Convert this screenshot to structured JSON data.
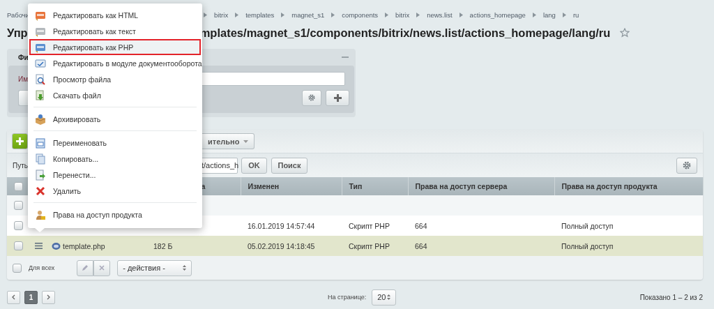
{
  "breadcrumbs": [
    "Рабочи",
    "bitrix",
    "templates",
    "magnet_s1",
    "components",
    "bitrix",
    "news.list",
    "actions_homepage",
    "lang",
    "ru"
  ],
  "title": {
    "start": "Упр",
    "end": "mplates/magnet_s1/components/bitrix/news.list/actions_homepage/lang/ru"
  },
  "filter": {
    "title": "Фи",
    "field_label": "Им"
  },
  "toolbar": {
    "more_label": "ительно"
  },
  "path": {
    "label": "Путь",
    "value": "t/actions_h",
    "ok": "OK",
    "search": "Поиск"
  },
  "table": {
    "all_checked": false,
    "columns": [
      "а",
      "Изменен",
      "Тип",
      "Права на доступ сервера",
      "Права на доступ продукта"
    ],
    "rows": [
      {
        "kind": "blank",
        "selected": false,
        "checked": false
      },
      {
        "kind": "file",
        "selected": false,
        "checked": false,
        "modified": "16.01.2019 14:57:44",
        "type": "Скрипт PHP",
        "server_rights": "664",
        "product_rights": "Полный доступ"
      },
      {
        "kind": "file",
        "selected": true,
        "checked": false,
        "name": "template.php",
        "size": "182 Б",
        "modified": "05.02.2019 14:18:45",
        "type": "Скрипт PHP",
        "server_rights": "664",
        "product_rights": "Полный доступ"
      }
    ]
  },
  "footer": {
    "all_checked": false,
    "all_label": "Для всех",
    "actions": "- действия -"
  },
  "pagination": {
    "pages": [
      {
        "label": "1",
        "selected": true
      }
    ],
    "per_page_label": "На странице:",
    "per_page": "20",
    "summary": "Показано 1 – 2 из 2"
  },
  "menu": {
    "items": [
      {
        "kind": "item",
        "label": "Редактировать как HTML",
        "selected": false
      },
      {
        "kind": "item",
        "label": "Редактировать как текст",
        "selected": false
      },
      {
        "kind": "item",
        "label": "Редактировать как PHP",
        "selected": true
      },
      {
        "kind": "item",
        "label": "Редактировать в модуле документооборота",
        "selected": false
      },
      {
        "kind": "item",
        "label": "Просмотр файла",
        "selected": false
      },
      {
        "kind": "item",
        "label": "Скачать файл",
        "selected": false
      },
      {
        "kind": "separator"
      },
      {
        "kind": "item",
        "label": "Архивировать",
        "selected": false
      },
      {
        "kind": "separator"
      },
      {
        "kind": "item",
        "label": "Переименовать",
        "selected": false
      },
      {
        "kind": "item",
        "label": "Копировать...",
        "selected": false
      },
      {
        "kind": "item",
        "label": "Перенести...",
        "selected": false
      },
      {
        "kind": "item",
        "label": "Удалить",
        "selected": false
      },
      {
        "kind": "separator"
      },
      {
        "kind": "item",
        "label": "Права на доступ продукта",
        "selected": false
      }
    ]
  }
}
